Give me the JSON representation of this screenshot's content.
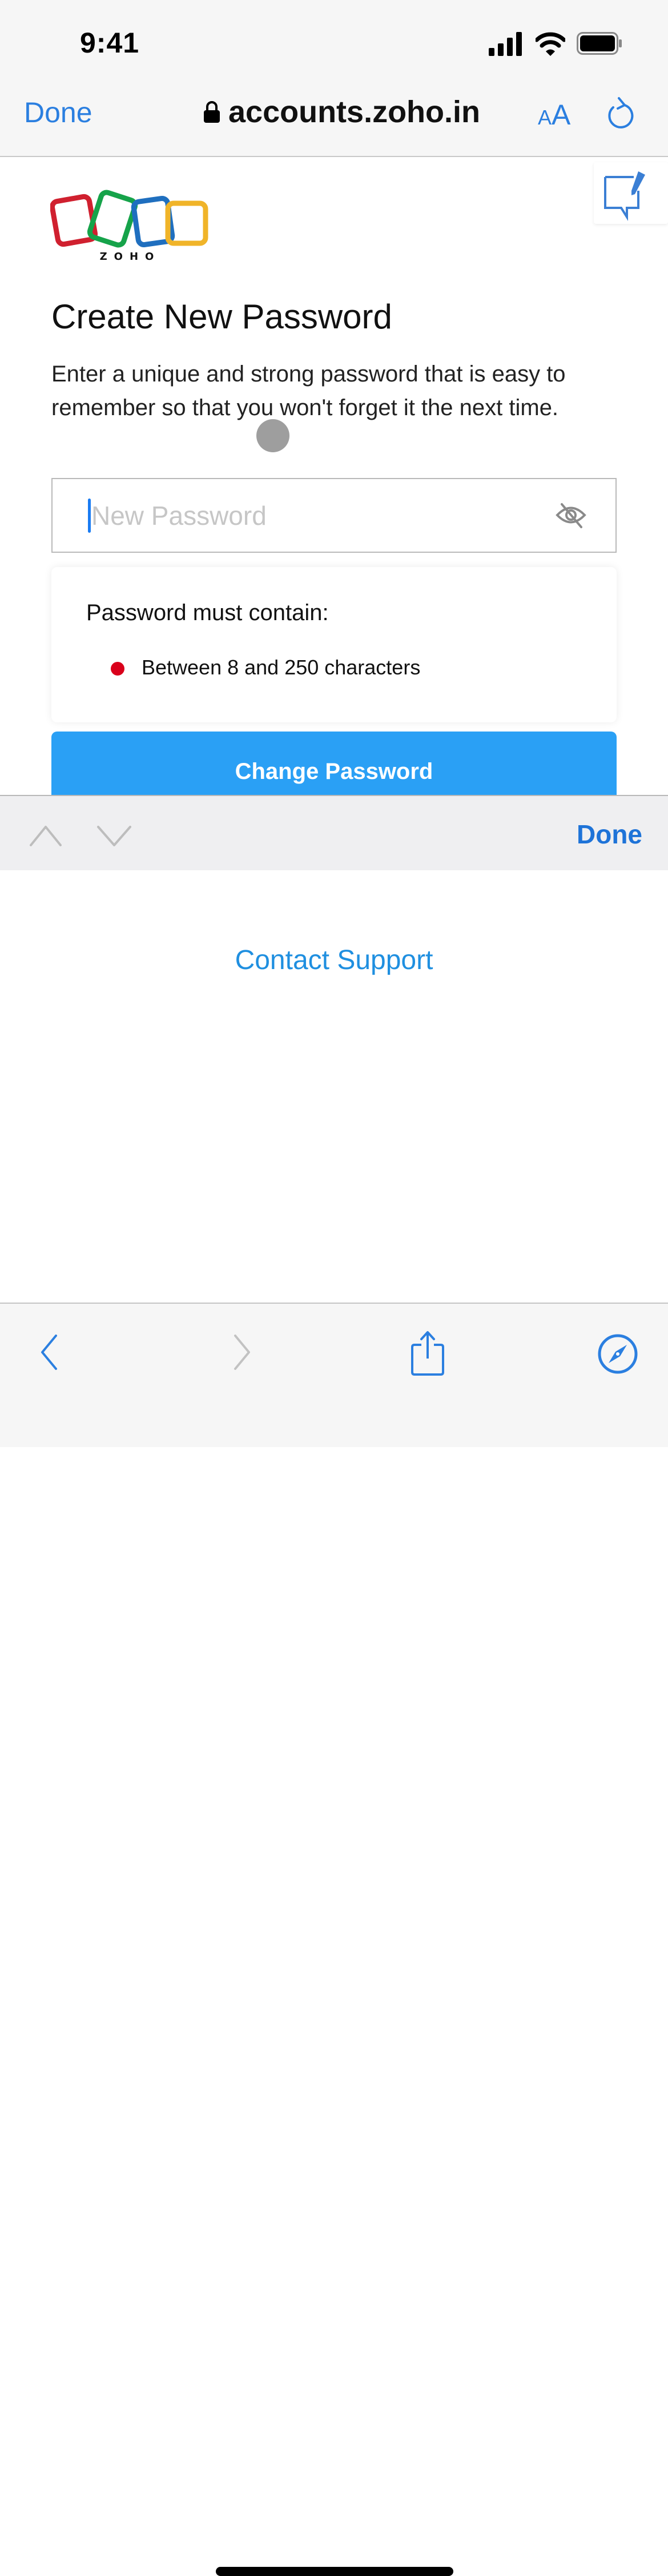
{
  "status_bar": {
    "time": "9:41"
  },
  "browser": {
    "done_label": "Done",
    "url": "accounts.zoho.in",
    "text_size_small": "A",
    "text_size_large": "A",
    "accent_color": "#2b7fe0"
  },
  "page": {
    "logo_text": "ZOHO",
    "heading": "Create New Password",
    "description": "Enter a unique and strong password that is easy to remember so that you won't forget it the next time.",
    "password_field": {
      "placeholder": "New Password",
      "value": ""
    },
    "rules": {
      "title": "Password must contain:",
      "items": [
        {
          "text": "Between 8 and 250 characters",
          "status": "unmet",
          "color": "#d9001b"
        }
      ]
    },
    "submit_label": "Change Password",
    "submit_color": "#2aa0f5",
    "contact_support": "Contact Support"
  },
  "keyboard_accessory": {
    "done_label": "Done"
  }
}
